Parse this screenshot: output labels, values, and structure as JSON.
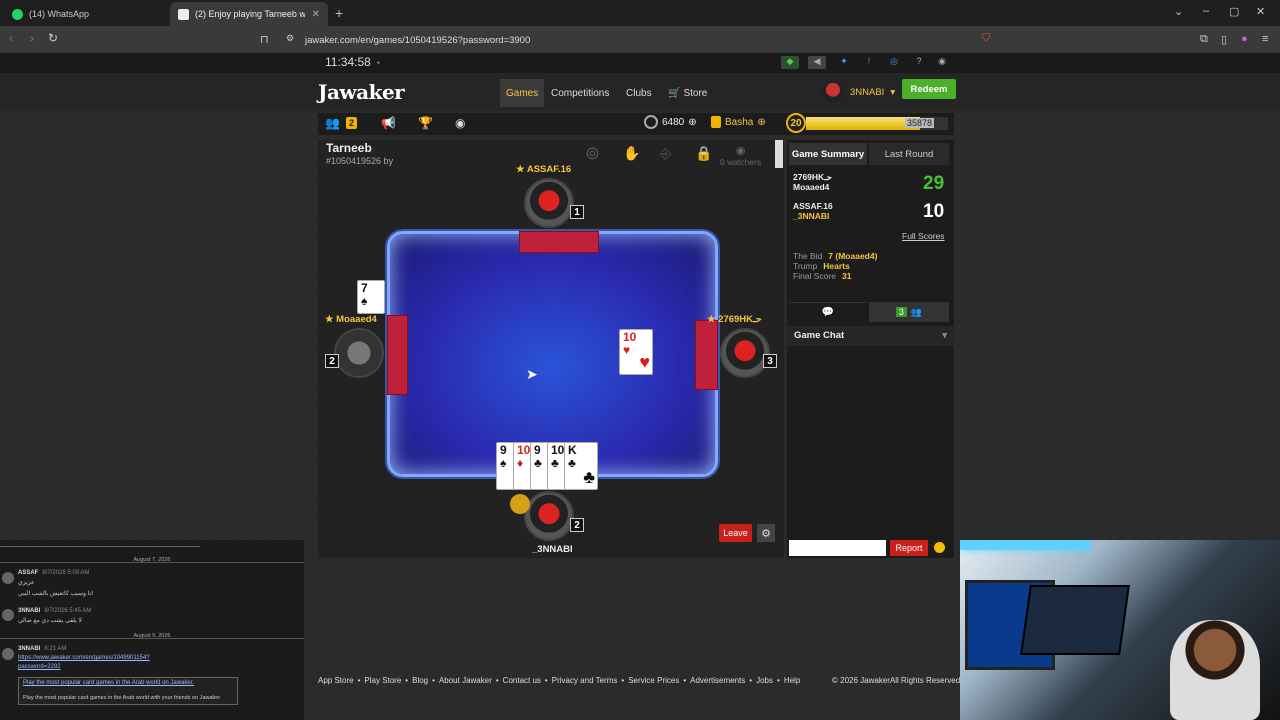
{
  "browser": {
    "tabs": [
      {
        "label": "(14) WhatsApp",
        "favicon_color": "#25d366"
      },
      {
        "label": "(2) Enjoy playing Tarneeb wit",
        "favicon_color": "#eeeeee"
      }
    ],
    "url": "jawaker.com/en/games/1050419526?password=3900"
  },
  "site": {
    "clock": "11:34:58",
    "logo": "Jawaker",
    "nav": [
      "Games",
      "Competitions",
      "Clubs",
      "Store"
    ],
    "username": "3NNABI",
    "redeem_label": "Redeem",
    "friends_count": "2",
    "coins": "6480",
    "basha_label": "Basha",
    "level": "20",
    "xp": "35878",
    "xp_fraction": 0.8
  },
  "game": {
    "title": "Tarneeb",
    "id_line": "#1050419526 by",
    "watchers": "0 watchers",
    "players": {
      "top": {
        "name": "ASSAF.16",
        "seat": "1"
      },
      "left": {
        "name": "Moaaed4",
        "seat": "2"
      },
      "right": {
        "name": "2769HKحـ",
        "seat": "3"
      },
      "bottom": {
        "name": "_3NNABI",
        "seat": "2"
      }
    },
    "played_card": {
      "rank": "10",
      "suit": "♥"
    },
    "left_corner_card": {
      "rank": "7",
      "suit": "♠"
    },
    "hand": [
      {
        "rank": "9",
        "suit": "♠",
        "color": "black"
      },
      {
        "rank": "10",
        "suit": "♦",
        "color": "red"
      },
      {
        "rank": "9",
        "suit": "♣",
        "color": "black"
      },
      {
        "rank": "10",
        "suit": "♣",
        "color": "black"
      },
      {
        "rank": "K",
        "suit": "♣",
        "color": "black"
      }
    ],
    "leave_label": "Leave"
  },
  "summary": {
    "tab_summary": "Game Summary",
    "tab_last_round": "Last Round",
    "teams": [
      {
        "p1": "2769HKحـ",
        "p2": "Moaaed4",
        "score": "29",
        "color": "#46c23a"
      },
      {
        "p1": "ASSAF.16",
        "p2": "_3NNABI",
        "score": "10",
        "color": "#ffffff"
      }
    ],
    "full_scores": "Full Scores",
    "bid_label": "The Bid",
    "bid_value": "7 (Moaaed4)",
    "trump_label": "Trump",
    "trump_value": "Hearts",
    "final_label": "Final Score",
    "final_value": "31",
    "online_count": "3",
    "chat_title": "Game Chat",
    "report_label": "Report"
  },
  "footer": {
    "links": [
      "App Store",
      "Play Store",
      "Blog",
      "About Jawaker",
      "Contact us",
      "Privacy and Terms",
      "Service Prices",
      "Advertisements",
      "Jobs",
      "Help"
    ],
    "copyright": "© 2026 JawakerAll Rights Reserved."
  },
  "overlay": {
    "date1": "August 7, 2026",
    "m1_user": "ASSAF",
    "m1_time": "8/7/2026 5:09 AM",
    "m1_l1": "عزيزي",
    "m1_l2": "انا وسيب كاتعيش بالشب اليبي",
    "m2_user": "3NNABI",
    "m2_time": "8/7/2026 5:45 AM",
    "m2_l1": "لا يلقى يشب دي مع صالي",
    "date2": "August 9, 2026",
    "m3_user": "3NNABI",
    "m3_time": "8:21 AM",
    "m3_link": "https://www.jawaker.com/en/games/1049901154?",
    "m3_extra": "password=2292",
    "card_title": "Play the most popular card games in the Arab world on Jawaker.",
    "card_desc": "Play the most popular card games in the Arab world with your friends on Jawaker"
  }
}
